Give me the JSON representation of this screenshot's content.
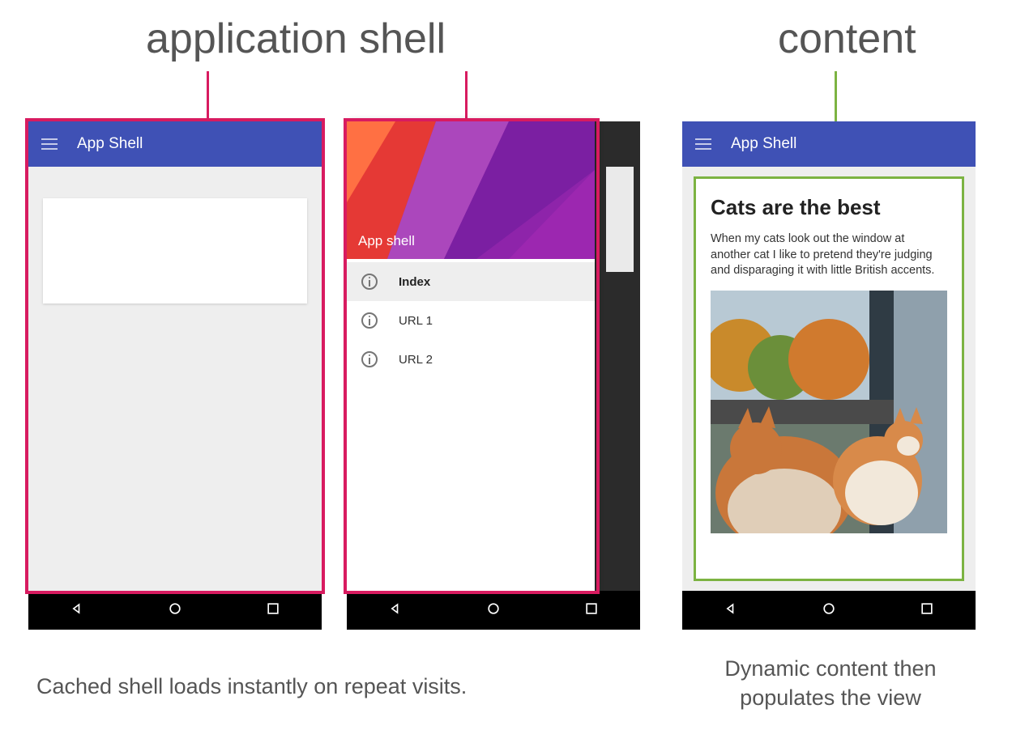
{
  "titles": {
    "application_shell": "application shell",
    "content": "content"
  },
  "captions": {
    "shell_caption_pre": "Cached shell loads ",
    "shell_caption_bold": "instantly",
    "shell_caption_post": " on repeat visits.",
    "content_caption": "Dynamic content then populates the view"
  },
  "appbar": {
    "title": "App Shell"
  },
  "drawer": {
    "header_label": "App shell",
    "items": [
      {
        "label": "Index",
        "active": true
      },
      {
        "label": "URL 1",
        "active": false
      },
      {
        "label": "URL 2",
        "active": false
      }
    ]
  },
  "content": {
    "heading": "Cats are the best",
    "body": "When my cats look out the window at another cat I like to pretend they're judging and disparaging it with little British accents."
  },
  "colors": {
    "outline_pink": "#d81b60",
    "outline_green": "#7cb342",
    "appbar": "#3f51b5"
  }
}
